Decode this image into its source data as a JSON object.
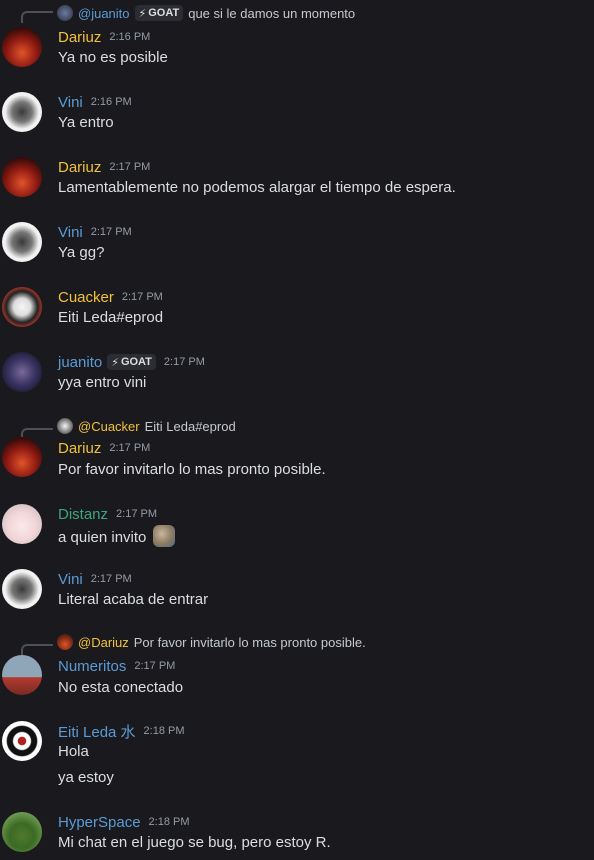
{
  "colors": {
    "background": "#1a1a1e",
    "text": "#dbdee1",
    "muted": "#949ba4",
    "name_yellow": "#f0c23a",
    "name_blue": "#5b9bd5",
    "name_green": "#3aa57a"
  },
  "top_reply": {
    "author": "@juanito",
    "tag": "GOAT",
    "text": "que si le damos un momento"
  },
  "messages": [
    {
      "author": "Dariuz",
      "time": "2:16 PM",
      "lines": [
        "Ya no es posible"
      ]
    },
    {
      "author": "Vini",
      "time": "2:16 PM",
      "lines": [
        "Ya entro"
      ]
    },
    {
      "author": "Dariuz",
      "time": "2:17 PM",
      "lines": [
        "Lamentablemente no podemos alargar el tiempo de espera."
      ]
    },
    {
      "author": "Vini",
      "time": "2:17 PM",
      "lines": [
        "Ya gg?"
      ]
    },
    {
      "author": "Cuacker",
      "time": "2:17 PM",
      "lines": [
        "Eiti Leda#eprod"
      ]
    },
    {
      "author": "juanito",
      "tag": "GOAT",
      "time": "2:17 PM",
      "lines": [
        "yya entro vini"
      ]
    },
    {
      "reply": {
        "author": "@Cuacker",
        "text": "Eiti Leda#eprod"
      },
      "author": "Dariuz",
      "time": "2:17 PM",
      "lines": [
        "Por favor invitarlo lo mas pronto posible."
      ]
    },
    {
      "author": "Distanz",
      "time": "2:17 PM",
      "lines": [
        "a quien invito"
      ],
      "emoji": "monkey-emoji"
    },
    {
      "author": "Vini",
      "time": "2:17 PM",
      "lines": [
        "Literal acaba de entrar"
      ]
    },
    {
      "reply": {
        "author": "@Dariuz",
        "text": "Por favor invitarlo lo mas pronto posible."
      },
      "author": "Numeritos",
      "time": "2:17 PM",
      "lines": [
        "No esta conectado"
      ]
    },
    {
      "author": "Eiti Leda 水",
      "time": "2:18 PM",
      "lines": [
        "Hola",
        "ya estoy"
      ]
    },
    {
      "author": "HyperSpace",
      "time": "2:18 PM",
      "lines": [
        "Mi chat en el juego se bug, pero estoy R."
      ]
    }
  ]
}
